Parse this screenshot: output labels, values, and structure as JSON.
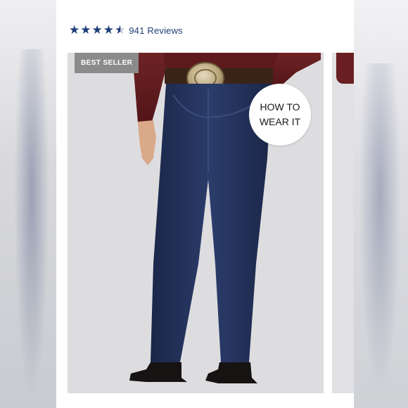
{
  "rating": {
    "stars_filled": 4.5,
    "stars_total": 5,
    "review_text": "941 Reviews"
  },
  "product": {
    "badge": "BEST SELLER",
    "how_to_line1": "HOW TO",
    "how_to_line2": "WEAR IT"
  },
  "colors": {
    "star": "#1d3e78",
    "badge_bg": "#8b8b8b",
    "denim": "#23325a",
    "shirt": "#6a1f22"
  },
  "icons": [
    "star-icon",
    "half-star-icon"
  ]
}
